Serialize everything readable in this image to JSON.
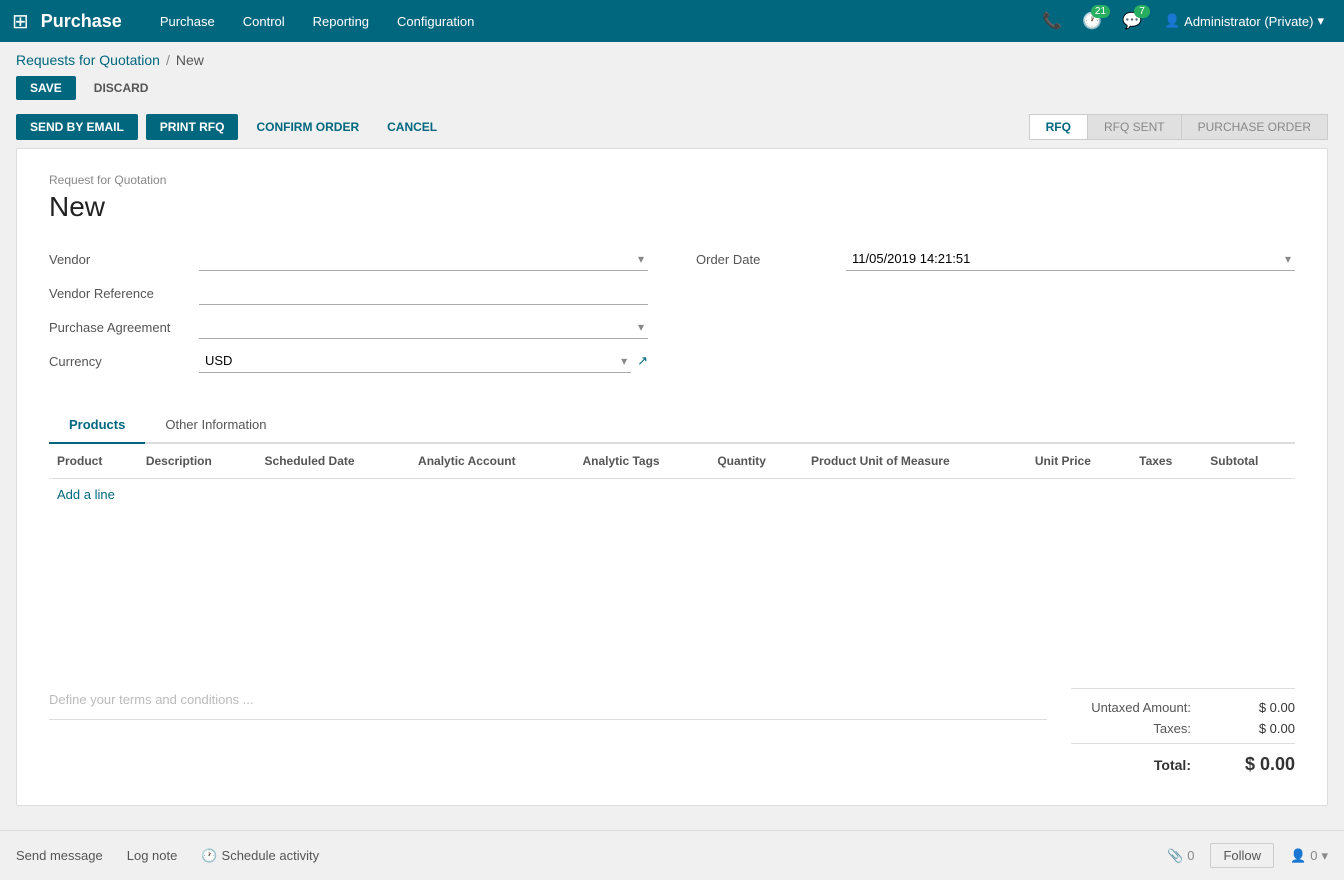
{
  "topnav": {
    "brand": "Purchase",
    "menu_items": [
      "Purchase",
      "Control",
      "Reporting",
      "Configuration"
    ],
    "badge_21": "21",
    "badge_7": "7",
    "user": "Administrator (Private)"
  },
  "breadcrumb": {
    "parent": "Requests for Quotation",
    "separator": "/",
    "current": "New"
  },
  "action_bar": {
    "save_label": "SAVE",
    "discard_label": "DISCARD"
  },
  "status_bar": {
    "send_email_label": "SEND BY EMAIL",
    "print_rfq_label": "PRINT RFQ",
    "confirm_order_label": "CONFIRM ORDER",
    "cancel_label": "CANCEL",
    "steps": [
      "RFQ",
      "RFQ SENT",
      "PURCHASE ORDER"
    ],
    "active_step": 0
  },
  "form": {
    "subtitle": "Request for Quotation",
    "title": "New",
    "vendor_label": "Vendor",
    "vendor_value": "",
    "vendor_placeholder": "",
    "order_date_label": "Order Date",
    "order_date_value": "11/05/2019 14:21:51",
    "vendor_reference_label": "Vendor Reference",
    "vendor_reference_value": "",
    "purchase_agreement_label": "Purchase Agreement",
    "purchase_agreement_value": "",
    "currency_label": "Currency",
    "currency_value": "USD"
  },
  "tabs": {
    "items": [
      "Products",
      "Other Information"
    ],
    "active": 0
  },
  "table": {
    "columns": [
      "Product",
      "Description",
      "Scheduled Date",
      "Analytic Account",
      "Analytic Tags",
      "Quantity",
      "Product Unit of Measure",
      "Unit Price",
      "Taxes",
      "Subtotal"
    ],
    "rows": [],
    "add_line_label": "Add a line"
  },
  "terms": {
    "placeholder": "Define your terms and conditions ..."
  },
  "totals": {
    "untaxed_label": "Untaxed Amount:",
    "untaxed_value": "$ 0.00",
    "taxes_label": "Taxes:",
    "taxes_value": "$ 0.00",
    "total_label": "Total:",
    "total_value": "$ 0.00"
  },
  "bottom_bar": {
    "send_message_label": "Send message",
    "log_note_label": "Log note",
    "schedule_activity_label": "Schedule activity",
    "messages_count": "0",
    "follow_label": "Follow",
    "followers_count": "0"
  }
}
